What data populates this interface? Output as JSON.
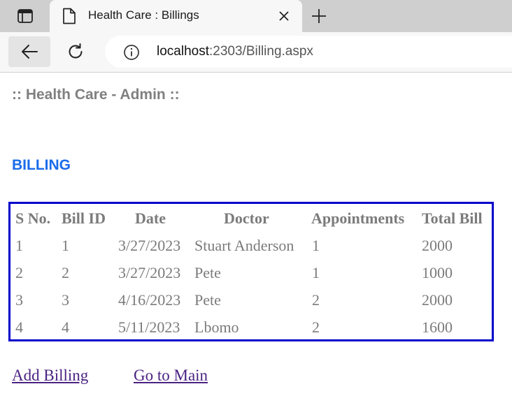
{
  "browser": {
    "tab_title": "Health Care : Billings",
    "url_host": "localhost",
    "url_path": ":2303/Billing.aspx"
  },
  "page": {
    "site_title": ":: Health Care - Admin ::",
    "section_heading": "BILLING"
  },
  "billing_table": {
    "headers": [
      "S No.",
      "Bill ID",
      "Date",
      "Doctor",
      "Appointments",
      "Total Bill"
    ],
    "rows": [
      [
        "1",
        "1",
        "3/27/2023",
        "Stuart Anderson",
        "1",
        "2000"
      ],
      [
        "2",
        "2",
        "3/27/2023",
        "Pete",
        "1",
        "1000"
      ],
      [
        "3",
        "3",
        "4/16/2023",
        "Pete",
        "2",
        "2000"
      ],
      [
        "4",
        "4",
        "5/11/2023",
        "Lbomo",
        "2",
        "1600"
      ]
    ]
  },
  "links": {
    "add_billing": "Add Billing",
    "go_to_main": "Go to Main"
  },
  "colors": {
    "heading_blue": "#1a6bea",
    "table_border": "#0000cc",
    "text_gray": "#7b7b7b",
    "link_visited": "#4b2382"
  },
  "icons": {
    "sidebar": "sidebar-icon",
    "favicon": "page-icon",
    "close": "close-icon",
    "new_tab": "plus-icon",
    "back": "back-arrow-icon",
    "reload": "reload-icon",
    "info": "info-icon"
  }
}
